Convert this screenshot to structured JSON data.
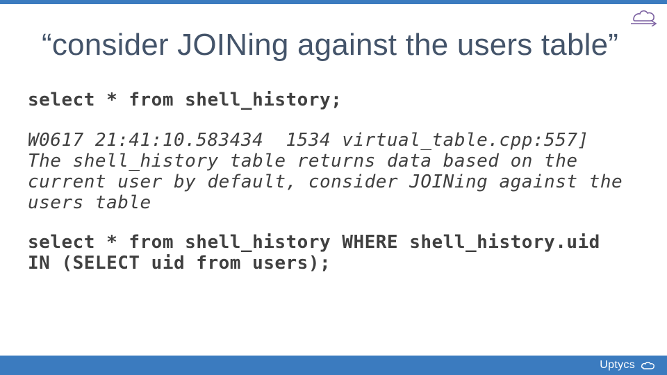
{
  "slide": {
    "title": "“consider JOINing against the users table”",
    "code_line_1": "select * from shell_history;",
    "log_message": "W0617 21:41:10.583434  1534 virtual_table.cpp:557] The shell_history table returns data based on the current user by default, consider JOINing against the users table",
    "code_line_2": "select * from shell_history WHERE shell_history.uid IN (SELECT uid from users);"
  },
  "footer": {
    "brand": "Uptycs"
  },
  "icons": {
    "corner_cloud": "cloud-arrow-icon",
    "footer_cloud": "cloud-icon"
  },
  "colors": {
    "accent": "#3b7bbf",
    "title": "#44546a",
    "body": "#404040",
    "corner_cloud_stroke": "#7a5fa0"
  }
}
